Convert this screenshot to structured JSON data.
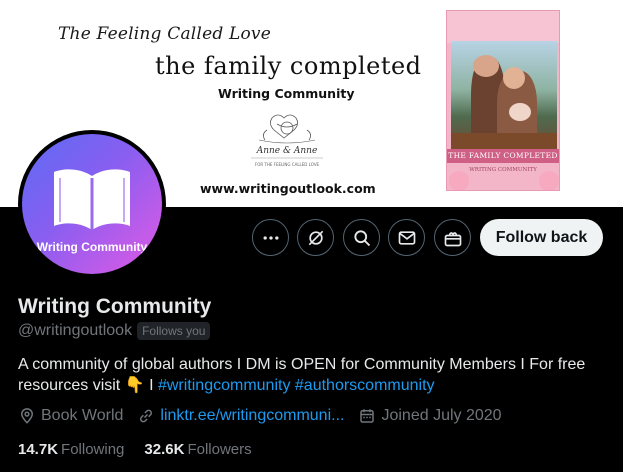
{
  "banner": {
    "script_title": "The Feeling Called Love",
    "main_title": "the family completed",
    "subtitle": "Writing Community",
    "logo_name": "Anne & Anne",
    "logo_tagline": "FOR THE FEELING CALLED LOVE",
    "website": "www.writingoutlook.com",
    "book_cover": {
      "title": "THE FAMILY COMPLETED",
      "subtitle": "WRITING COMMUNITY"
    }
  },
  "avatar": {
    "label": "Writing Community",
    "icon": "open-book-icon"
  },
  "actions": {
    "more_icon": "more-icon",
    "grok_icon": "grok-icon",
    "search_icon": "search-icon",
    "message_icon": "message-icon",
    "subscribe_icon": "subscribe-icon",
    "follow_label": "Follow back"
  },
  "profile": {
    "name": "Writing Community",
    "handle": "@writingoutlook",
    "follows_you": "Follows you",
    "bio_text": "A community of global authors I DM is OPEN for Community Members I For free resources visit ",
    "bio_emoji": "👇",
    "bio_separator": " I ",
    "hashtag_1": "#writingcommunity",
    "hashtag_2": "#authorscommunity",
    "location": "Book World",
    "link": "linktr.ee/writingcommuni...",
    "joined": "Joined July 2020",
    "following_count": "14.7K",
    "following_label": "Following",
    "followers_count": "32.6K",
    "followers_label": "Followers"
  },
  "colors": {
    "accent": "#1d9bf0",
    "text_primary": "#e7e9ea",
    "text_secondary": "#71767b",
    "background": "#000000"
  }
}
